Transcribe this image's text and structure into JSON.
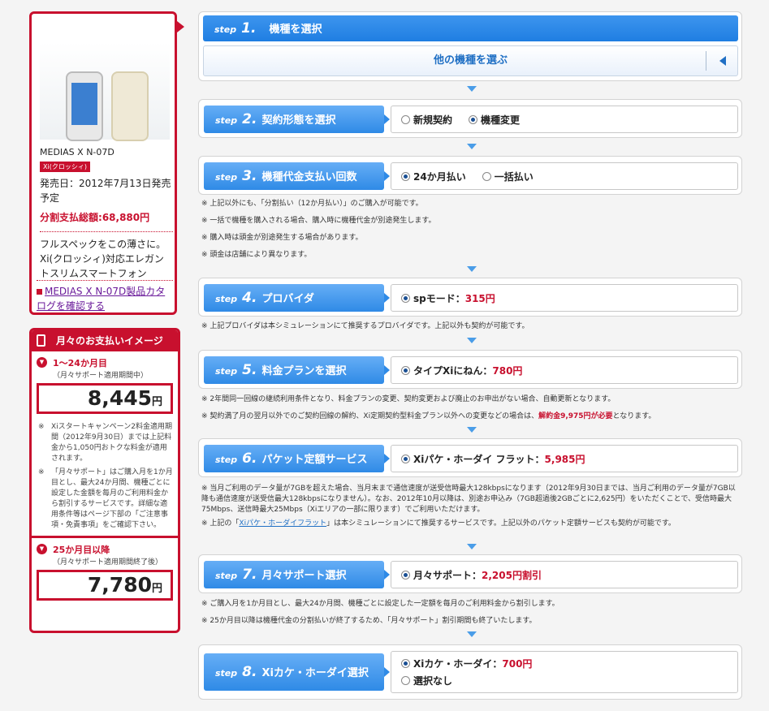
{
  "product": {
    "name": "MEDIAS X N-07D",
    "badge": "Xi(クロッシィ)",
    "release": "発売日：2012年7月13日発売予定",
    "total_label": "分割支払総額:",
    "total_value": "68,880円",
    "description": "フルスペックをこの薄さに。Xi(クロッシィ)対応エレガントスリムスマートフォン",
    "catalog_link": "MEDIAS X N-07D製品カタログを確認する"
  },
  "payment": {
    "title": "月々のお支払いイメージ",
    "period1_title": "1〜24か月目",
    "period1_note": "（月々サポート適用期間中）",
    "period1_amount": "8,445",
    "yen": "円",
    "notes": [
      "Xiスタートキャンペーン2料金適用期間（2012年9月30日）までは上記料金から1,050円おトクな料金が適用されます。",
      "「月々サポート」はご購入月を1か月目とし、最大24か月間、機種ごとに設定した金額を毎月のご利用料金から割引するサービスです。詳細な適用条件等はページ下部の「ご注意事項・免責事項」をご確認下さい。"
    ],
    "period2_title": "25か月目以降",
    "period2_note": "（月々サポート適用期間終了後）",
    "period2_amount": "7,780"
  },
  "steps": {
    "step_word": "step",
    "s1": {
      "num": "1.",
      "title": "機種を選択",
      "choose": "他の機種を選ぶ"
    },
    "s2": {
      "num": "2.",
      "title": "契約形態を選択",
      "opt1": "新規契約",
      "opt2": "機種変更"
    },
    "s3": {
      "num": "3.",
      "title": "機種代金支払い回数",
      "opt1": "24か月払い",
      "opt2": "一括払い",
      "notes": [
        "※ 上記以外にも、「分割払い（12か月払い）」のご購入が可能です。",
        "※ 一括で機種を購入される場合、購入時に機種代金が別途発生します。",
        "※ 購入時は頭金が別途発生する場合があります。",
        "※ 頭金は店舗により異なります。"
      ]
    },
    "s4": {
      "num": "4.",
      "title": "プロバイダ",
      "opt1_label": "spモード：",
      "opt1_price": "315円",
      "note": "※ 上記プロバイダは本シミュレーションにて推奨するプロバイダです。上記以外も契約が可能です。"
    },
    "s5": {
      "num": "5.",
      "title": "料金プランを選択",
      "opt1_label": "タイプXiにねん：",
      "opt1_price": "780円",
      "note1": "※ 2年間同一回線の継続利用条件となり、料金プランの変更、契約変更および廃止のお申出がない場合、自動更新となります。",
      "note2_a": "※ 契約満了月の翌月以外でのご契約回線の解約、Xi定期契約型料金プラン以外への変更などの場合は、",
      "note2_red": "解約金9,975円が必要",
      "note2_b": "となります。"
    },
    "s6": {
      "num": "6.",
      "title": "パケット定額サービス",
      "opt1_label": "Xiパケ・ホーダイ フラット：",
      "opt1_price": "5,985円",
      "note1": "※ 当月ご利用のデータ量が7GBを超えた場合、当月末まで通信速度が送受信時最大128kbpsになります（2012年9月30日までは、当月ご利用のデータ量が7GB以降も通信速度が送受信最大128kbpsになりません）。なお、2012年10月以降は、別途お申込み（7GB超過後2GBごとに2,625円）をいただくことで、受信時最大75Mbps、送信時最大25Mbps（Xiエリアの一部に限ります）でご利用いただけます。",
      "note2_a": "※ 上記の「",
      "note2_link": "Xiパケ・ホーダイフラット",
      "note2_b": "」は本シミュレーションにて推奨するサービスです。上記以外のパケット定額サービスも契約が可能です。"
    },
    "s7": {
      "num": "7.",
      "title": "月々サポート選択",
      "opt1_label": "月々サポート：",
      "opt1_price": "2,205円割引",
      "note1": "※ ご購入月を1か月目とし、最大24か月間、機種ごとに設定した一定額を毎月のご利用料金から割引します。",
      "note2": "※ 25か月目以降は機種代金の分割払いが終了するため、「月々サポート」割引期間も終了いたします。"
    },
    "s8": {
      "num": "8.",
      "title": "Xiカケ・ホーダイ選択",
      "opt1_label": "Xiカケ・ホーダイ：",
      "opt1_price": "700円",
      "opt2": "選択なし"
    }
  }
}
